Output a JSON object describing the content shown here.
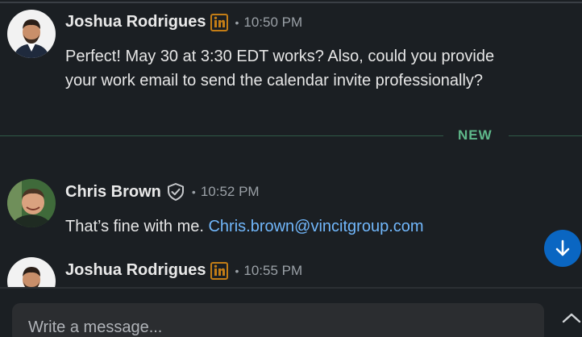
{
  "messages": [
    {
      "sender": "Joshua Rodrigues",
      "time": "10:50 PM",
      "text_lines": [
        "Perfect! May 30 at 3:30 EDT works? Also, could you provide",
        "your work email to send the calendar invite professionally?"
      ]
    },
    {
      "sender": "Chris Brown",
      "time": "10:52 PM",
      "text": "That’s fine with me. ",
      "link": "Chris.brown@vincitgroup.com"
    },
    {
      "sender": "Joshua Rodrigues",
      "time": "10:55 PM"
    }
  ],
  "separator": {
    "label": "NEW"
  },
  "composer": {
    "placeholder": "Write a message..."
  },
  "icons": {
    "linkedin_badge": "linkedin-icon",
    "verified_badge": "shield-check-icon",
    "scroll_down": "arrow-down-icon",
    "expand": "chevron-up-icon"
  },
  "colors": {
    "background": "#1b1f23",
    "link": "#71b7fb",
    "new_label": "#5fb88a",
    "scroll_button": "#0a66c2",
    "linkedin_badge": "#c37d16"
  }
}
